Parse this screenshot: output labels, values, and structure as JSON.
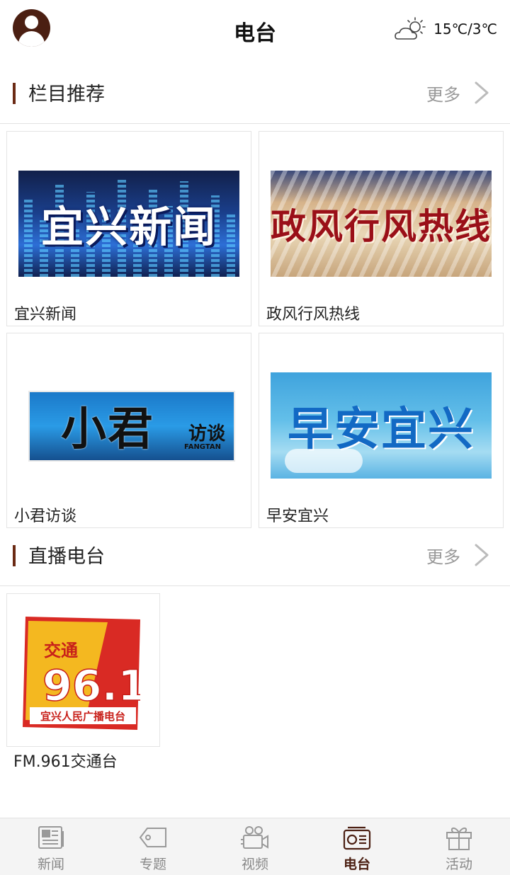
{
  "header": {
    "title": "电台",
    "weather_icon": "partly-cloudy-icon",
    "temperature": "15℃/3℃"
  },
  "section_columns": {
    "label": "栏目推荐",
    "more": "更多",
    "cards": [
      {
        "caption": "宜兴新闻",
        "banner_text": "宜兴新闻"
      },
      {
        "caption": "政风行风热线",
        "banner_text": "政风行风热线"
      },
      {
        "caption": "小君访谈",
        "banner_text": "小君",
        "banner_sub": "访谈",
        "banner_sub2": "FANGTAN"
      },
      {
        "caption": "早安宜兴",
        "banner_text": "早安宜兴"
      }
    ]
  },
  "section_live": {
    "label": "直播电台",
    "more": "更多",
    "stations": [
      {
        "caption": "FM.961交通台",
        "logo_top": "交通",
        "logo_number": "96.1",
        "logo_bottom": "宜兴人民广播电台"
      }
    ]
  },
  "tabbar": {
    "tabs": [
      {
        "label": "新闻",
        "icon": "newspaper-icon",
        "active": false
      },
      {
        "label": "专题",
        "icon": "tag-icon",
        "active": false
      },
      {
        "label": "视频",
        "icon": "video-camera-icon",
        "active": false
      },
      {
        "label": "电台",
        "icon": "radio-icon",
        "active": true
      },
      {
        "label": "活动",
        "icon": "gift-icon",
        "active": false
      }
    ]
  },
  "colors": {
    "accent": "#4b1f12",
    "section_bar": "#6b2a14",
    "muted_text": "#999999",
    "tab_inactive": "#888888"
  }
}
